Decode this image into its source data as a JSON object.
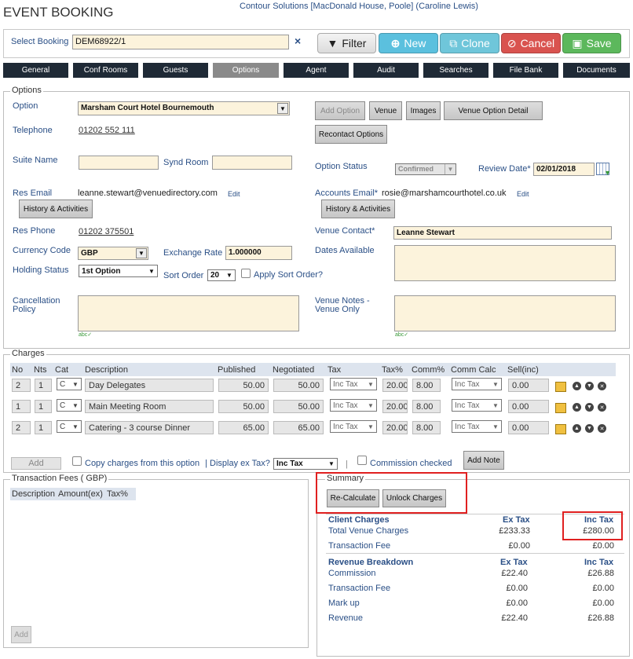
{
  "header": {
    "title": "EVENT BOOKING",
    "context": "Contour Solutions [MacDonald House, Poole] (Caroline Lewis)"
  },
  "booking": {
    "label": "Select Booking",
    "value": "DEM68922/1",
    "clear": "×"
  },
  "toolbar": {
    "filter": "Filter",
    "new": "New",
    "clone": "Clone",
    "cancel": "Cancel",
    "save": "Save"
  },
  "tabs": [
    "General",
    "Conf Rooms",
    "Guests",
    "Options",
    "Agent",
    "Audit",
    "Searches",
    "File Bank",
    "Documents"
  ],
  "options": {
    "legend": "Options",
    "option_label": "Option",
    "option_value": "Marsham Court Hotel Bournemouth",
    "btn_add_option": "Add Option",
    "btn_venue": "Venue",
    "btn_images": "Images",
    "btn_venue_option_detail": "Venue Option Detail",
    "btn_recontact": "Recontact Options",
    "telephone_label": "Telephone",
    "telephone_value": "01202 552 111",
    "suite_label": "Suite Name",
    "synd_label": "Synd Room",
    "status_label": "Option Status",
    "status_value": "Confirmed",
    "review_label": "Review Date*",
    "review_value": "02/01/2018",
    "res_email_label": "Res Email",
    "res_email_value": "leanne.stewart@venuedirectory.com",
    "edit": "Edit",
    "accounts_email_label": "Accounts Email*",
    "accounts_email_value": "rosie@marshamcourthotel.co.uk",
    "history_btn": "History & Activities",
    "res_phone_label": "Res Phone",
    "res_phone_value": "01202 375501",
    "venue_contact_label": "Venue Contact*",
    "venue_contact_value": "Leanne Stewart",
    "currency_label": "Currency Code",
    "currency_value": "GBP",
    "exchange_label": "Exchange Rate",
    "exchange_value": "1.000000",
    "dates_label": "Dates Available",
    "holding_label": "Holding Status",
    "holding_value": "1st Option",
    "sort_label": "Sort Order",
    "sort_value": "20",
    "apply_sort_label": "Apply Sort Order?",
    "cancellation_label1": "Cancellation",
    "cancellation_label2": "Policy",
    "venue_notes_label1": "Venue Notes -",
    "venue_notes_label2": "Venue Only"
  },
  "charges": {
    "legend": "Charges",
    "headers": [
      "No",
      "Nts",
      "Cat",
      "Description",
      "Published",
      "Negotiated",
      "Tax",
      "Tax%",
      "Comm%",
      "Comm Calc",
      "Sell(inc)"
    ],
    "rows": [
      {
        "no": "2",
        "nts": "1",
        "cat": "C",
        "desc": "Day Delegates",
        "pub": "50.00",
        "neg": "50.00",
        "tax": "Inc Tax",
        "taxp": "20.00",
        "comm": "8.00",
        "calc": "Inc Tax",
        "sell": "0.00"
      },
      {
        "no": "1",
        "nts": "1",
        "cat": "C",
        "desc": "Main Meeting Room",
        "pub": "50.00",
        "neg": "50.00",
        "tax": "Inc Tax",
        "taxp": "20.00",
        "comm": "8.00",
        "calc": "Inc Tax",
        "sell": "0.00"
      },
      {
        "no": "2",
        "nts": "1",
        "cat": "C",
        "desc": "Catering - 3 course Dinner",
        "pub": "65.00",
        "neg": "65.00",
        "tax": "Inc Tax",
        "taxp": "20.00",
        "comm": "8.00",
        "calc": "Inc Tax",
        "sell": "0.00"
      }
    ],
    "add": "Add",
    "copy_label": "Copy charges from this option",
    "sep": "|",
    "display_ex_label": "Display ex Tax?",
    "display_value": "Inc Tax",
    "pipe": "|",
    "commission_label": "Commission checked",
    "add_note": "Add Note"
  },
  "transaction": {
    "legend": "Transaction Fees ( GBP)",
    "headers": [
      "Description",
      "Amount(ex)",
      "Tax%"
    ],
    "add": "Add"
  },
  "summary": {
    "legend": "Summary",
    "recalc": "Re-Calculate",
    "unlock": "Unlock Charges",
    "client_charges": "Client Charges",
    "ex_tax": "Ex Tax",
    "inc_tax": "Inc Tax",
    "total_venue": "Total Venue Charges",
    "total_ex": "£233.33",
    "total_inc": "£280.00",
    "trans_fee": "Transaction Fee",
    "trans_ex": "£0.00",
    "trans_inc": "£0.00",
    "revenue_breakdown": "Revenue Breakdown",
    "commission": "Commission",
    "comm_ex": "£22.40",
    "comm_inc": "£26.88",
    "trans_fee2": "Transaction Fee",
    "trans2_ex": "£0.00",
    "trans2_inc": "£0.00",
    "markup": "Mark up",
    "markup_ex": "£0.00",
    "markup_inc": "£0.00",
    "revenue": "Revenue",
    "rev_ex": "£22.40",
    "rev_inc": "£26.88"
  }
}
